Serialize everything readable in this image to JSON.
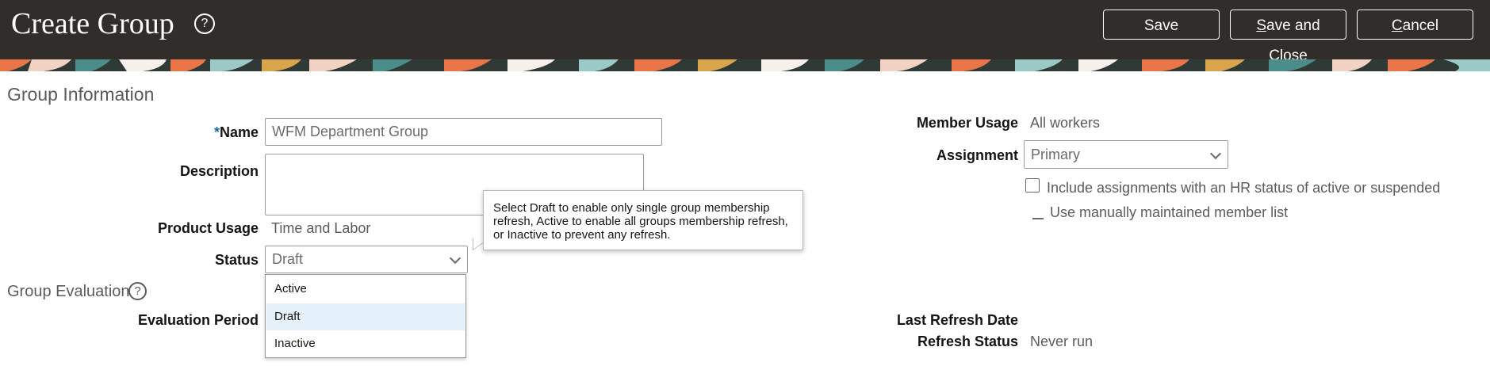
{
  "header": {
    "title": "Create Group",
    "save_label": "Save",
    "save_close_first": "S",
    "save_close_rest": "ave and Close",
    "cancel_first": "C",
    "cancel_rest": "ancel"
  },
  "group_information": {
    "section_title": "Group Information",
    "name_required_mark": "*",
    "name_label": "Name",
    "name_value": "WFM Department Group",
    "description_label": "Description",
    "description_value": "",
    "product_usage_label": "Product Usage",
    "product_usage_value": "Time and Labor",
    "status_label": "Status",
    "status_value": "Draft",
    "status_options": [
      "Active",
      "Draft",
      "Inactive"
    ],
    "status_tooltip": "Select Draft to enable only single group membership refresh, Active to enable all groups membership refresh, or Inactive to prevent any refresh.",
    "member_usage_label": "Member Usage",
    "member_usage_value": "All workers",
    "assignment_label": "Assignment",
    "assignment_value": "Primary",
    "include_assignments_label": "Include assignments with an HR status of active or suspended",
    "manual_list_label": "Use manually maintained member list"
  },
  "group_evaluation": {
    "section_title": "Group Evaluation",
    "evaluation_period_label": "Evaluation Period",
    "last_refresh_date_label": "Last Refresh Date",
    "refresh_status_label": "Refresh Status",
    "refresh_status_value": "Never run"
  },
  "colors": {
    "header_bg": "#312d2a",
    "selected_option_bg": "#e4f1fb"
  }
}
